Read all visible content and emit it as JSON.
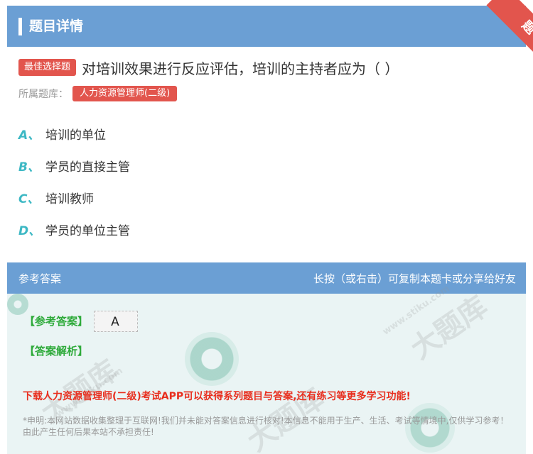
{
  "header": {
    "title": "题目详情"
  },
  "corner_ribbon": {
    "label": "题卡"
  },
  "question": {
    "type_badge": "最佳选择题",
    "text": "对培训效果进行反应评估，培训的主持者应为（ ）"
  },
  "category": {
    "label": "所属题库：",
    "value": "人力资源管理师(二级)"
  },
  "options": [
    {
      "letter": "A、",
      "text": "培训的单位"
    },
    {
      "letter": "B、",
      "text": "学员的直接主管"
    },
    {
      "letter": "C、",
      "text": "培训教师"
    },
    {
      "letter": "D、",
      "text": "学员的单位主管"
    }
  ],
  "answer_panel": {
    "title": "参考答案",
    "hint": "长按（或右击）可复制本题卡或分享给好友",
    "ref_label": "【参考答案】",
    "ref_value": "A",
    "analysis_label": "【答案解析】",
    "promo": "下载人力资源管理师(二级)考试APP可以获得系列题目与答案,还有练习等更多学习功能!",
    "disclaimer": "*申明:本网站数据收集整理于互联网!我们并未能对答案信息进行核对!本信息不能用于生产、生活、考试等情境中,仅供学习参考！由此产生任何后果本站不承担责任!"
  },
  "watermark": {
    "text": "大题库",
    "url": "www.stiku.com"
  },
  "colors": {
    "header": "#6b9fd4",
    "badge": "#e2554d",
    "option_letter": "#3db8c4",
    "answer_label": "#2eaa3a",
    "promo": "#e82e1e"
  }
}
